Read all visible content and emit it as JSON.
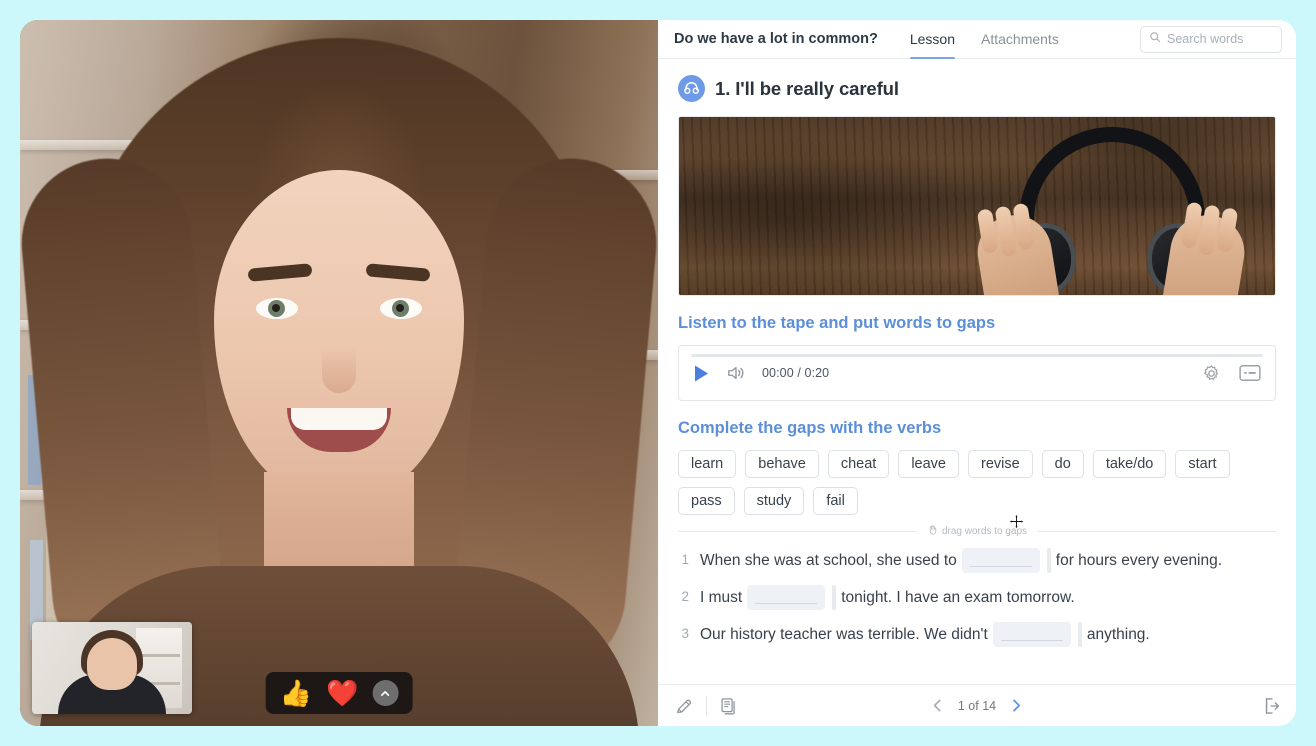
{
  "header": {
    "lesson_title": "Do we have a lot in common?",
    "tabs": [
      {
        "label": "Lesson",
        "active": true
      },
      {
        "label": "Attachments",
        "active": false
      }
    ],
    "search": {
      "placeholder": "Search words",
      "value": "",
      "icon": "search-icon"
    }
  },
  "task": {
    "icon": "headphones-icon",
    "icon_color": "#6e9ae8",
    "title": "1. I'll be really careful",
    "hero_image_alt": "hands holding black headphones on dark wooden table"
  },
  "sections": {
    "listening_heading": "Listen to the tape and put words to gaps",
    "gaps_heading": "Complete the gaps with the verbs",
    "heading_color": "#5d8fd8"
  },
  "audio": {
    "play_icon": "play-icon",
    "volume_icon": "volume-icon",
    "current_time": "00:00",
    "separator": "/",
    "duration": "0:20",
    "time_display": "00:00 / 0:20",
    "settings_icon": "gear-icon",
    "captions_icon": "miniplayer-icon",
    "progress_percent": 0,
    "accent_color": "#4a7fe0"
  },
  "word_bank": {
    "words": [
      "learn",
      "behave",
      "cheat",
      "leave",
      "revise",
      "do",
      "take/do",
      "start",
      "pass",
      "study",
      "fail"
    ],
    "hint": "drag words to gaps",
    "hint_icon": "drag-hand-icon"
  },
  "exercise": {
    "items": [
      {
        "num": "1",
        "before": "When she was at school, she used to",
        "gap": "",
        "after": "for hours every evening."
      },
      {
        "num": "2",
        "before": "I must",
        "gap": "",
        "after": "tonight. I have an exam tomorrow."
      },
      {
        "num": "3",
        "before": "Our history teacher was terrible. We didn't",
        "gap": "",
        "after": "anything."
      }
    ]
  },
  "footer": {
    "annotate_icon": "pencil-icon",
    "pages_icon": "documents-icon",
    "prev_icon": "chevron-left-icon",
    "next_icon": "chevron-right-icon",
    "page_label": "1 of 14",
    "current_page": 1,
    "total_pages": 14,
    "exit_icon": "exit-icon"
  },
  "video": {
    "reactions": [
      {
        "name": "thumbs-up-reaction",
        "glyph": "👍"
      },
      {
        "name": "heart-reaction",
        "glyph": "❤️"
      }
    ],
    "more_icon": "chevron-up-icon",
    "self_view_label": "self-view"
  },
  "theme": {
    "page_background": "#ccf7fb",
    "panel_background": "#ffffff",
    "accent_blue": "#5d8fd8"
  }
}
